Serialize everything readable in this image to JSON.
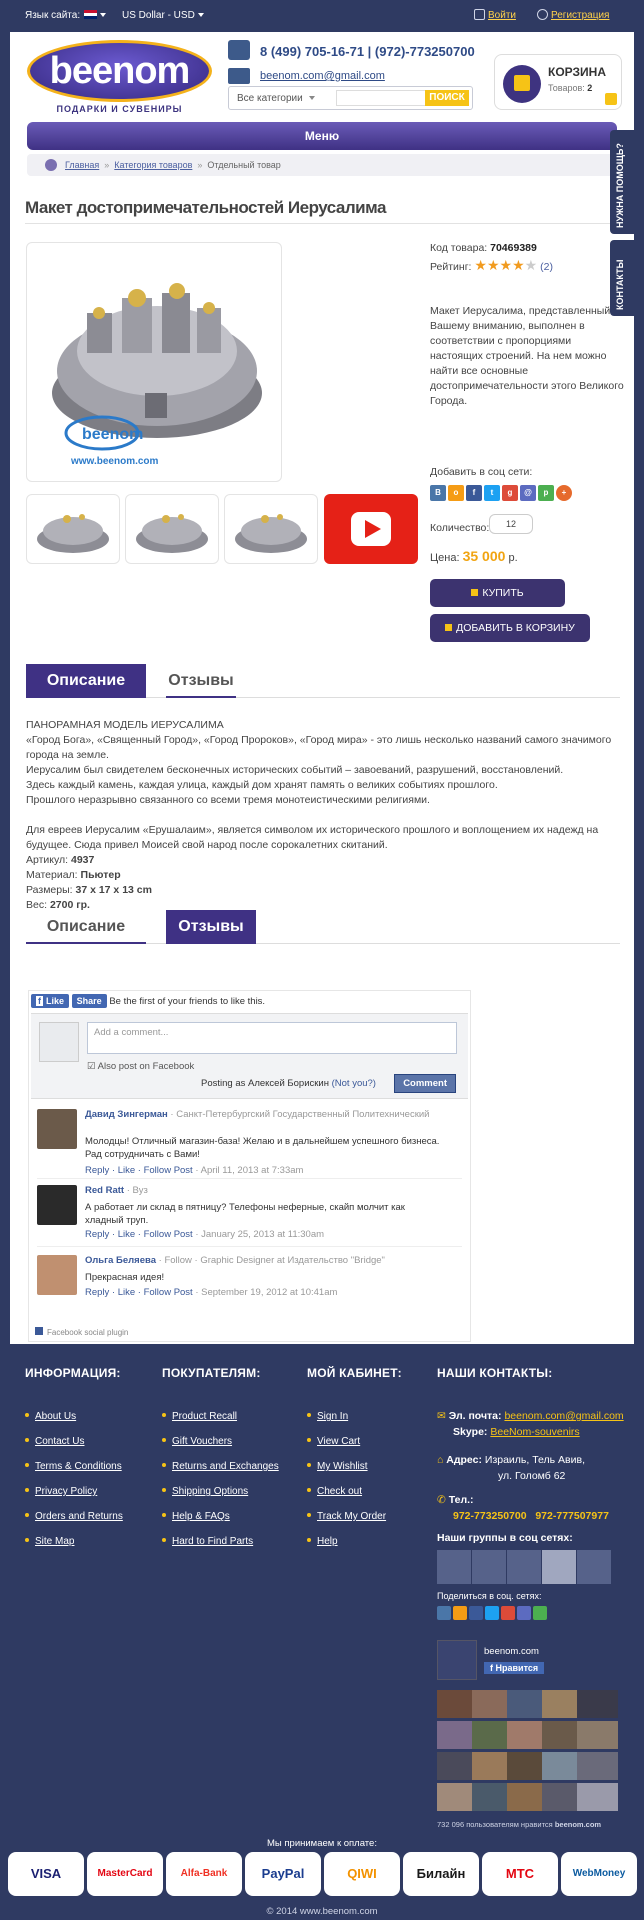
{
  "topbar": {
    "lang_label": "Язык сайта:",
    "currency": "US Dollar - USD",
    "login": "Войти",
    "register": "Регистрация"
  },
  "header": {
    "logo_text": "beenom",
    "logo_sub": "ПОДАРКИ И СУВЕНИРЫ",
    "phone": "8 (499) 705-16-71  |  (972)-773250700",
    "email": "beenom.com@gmail.com",
    "search_category": "Все категории",
    "search_button": "ПОИСК",
    "cart_title": "КОРЗИНА",
    "cart_items_label": "Товаров:",
    "cart_items_count": "2"
  },
  "menu": {
    "label": "Меню"
  },
  "breadcrumb": {
    "home": "Главная",
    "category": "Категория товаров",
    "current": "Отдельный товар"
  },
  "side_tabs": {
    "help": "НУЖНА ПОМОЩЬ?",
    "contacts": "КОНТАКТЫ"
  },
  "product": {
    "title": "Макет достопримечательностей Иерусалима",
    "code_label": "Код товара:",
    "code": "70469389",
    "rating_label": "Рейтинг:",
    "rating": 4,
    "rating_max": 5,
    "reviews": "(2)",
    "description": "Макет Иерусалима, представленный Вашему вниманию, выполнен в соответствии с пропорциями настоящих строений. На нем можно найти все основные достопримечательности этого Великого Города.",
    "share_label": "Добавить в соц сети:",
    "qty_label": "Количество:",
    "qty": "12",
    "price_label": "Цена:",
    "price": "35 000",
    "currency": "р.",
    "buy": "КУПИТЬ",
    "add_to_cart": "ДОБАВИТЬ В КОРЗИНУ",
    "watermark": "www.beenom.com"
  },
  "tabs": {
    "description": "Описание",
    "reviews": "Отзывы"
  },
  "details": {
    "heading": "ПАНОРАМНАЯ МОДЕЛЬ ИЕРУСАЛИМА",
    "p1": "«Город Бога», «Священный Город», «Город Пророков», «Город мира» - это лишь несколько названий самого значимого города на земле.",
    "p2": "Иерусалим был свидетелем бесконечных исторических событий – завоеваний, разрушений, восстановлений.",
    "p3": "Здесь каждый камень, каждая улица, каждый дом хранят память о великих событиях прошлого.",
    "p4": "Прошлого неразрывно связанного со всеми тремя монотеистическими религиями.",
    "p5": "Для евреев Иерусалим «Ерушалаим», является символом их исторического прошлого и воплощением их надежд на будущее. Сюда привел Моисей свой народ после сорокалетних скитаний.",
    "sku_label": "Артикул:",
    "sku": "4937",
    "material_label": "Материал:",
    "material": "Пьютер",
    "size_label": "Размеры:",
    "size": "37 x 17 x 13 cm",
    "weight_label": "Вес:",
    "weight": "2700 гр."
  },
  "facebook": {
    "like": "Like",
    "share": "Share",
    "first": "Be the first of your friends to like this.",
    "placeholder": "Add a comment...",
    "also_post": "Also post on Facebook",
    "posting_as": "Posting as Алексей Борискин",
    "not_you": "(Not you?)",
    "comment_btn": "Comment",
    "plugin": "Facebook social plugin",
    "comments": [
      {
        "name": "Давид Зингерман",
        "meta": " · Санкт-Петербургский Государственный Политехнический",
        "text": "Молодцы! Отличный магазин-база! Желаю и в дальнейшем успешного бизнеса. Рад сотрудничать с Вами!",
        "actions": "Reply · Like · Follow Post",
        "date": " · April 11, 2013 at 7:33am"
      },
      {
        "name": "Red Ratt",
        "meta": " · Вуз",
        "text": "А работает ли склад в пятницу? Телефоны неферные, скайп молчит как хладный труп.",
        "actions": "Reply · Like · Follow Post",
        "date": " · January 25, 2013 at 11:30am"
      },
      {
        "name": "Ольга Беляева",
        "meta": " · Follow · Graphic Designer at Издательство \"Bridge\"",
        "text": "Прекрасная идея!",
        "actions": "Reply · Like · Follow Post",
        "date": " · September 19, 2012 at 10:41am"
      }
    ]
  },
  "footer": {
    "info_title": "ИНФОРМАЦИЯ:",
    "info_links": [
      "About Us",
      "Contact Us",
      "Terms & Conditions",
      "Privacy Policy",
      "Orders and Returns",
      "Site Map"
    ],
    "buyers_title": "ПОКУПАТЕЛЯМ:",
    "buyers_links": [
      "Product Recall",
      "Gift Vouchers",
      "Returns and Exchanges",
      "Shipping Options",
      "Help & FAQs",
      "Hard to Find Parts"
    ],
    "cabinet_title": "МОЙ КАБИНЕТ:",
    "cabinet_links": [
      "Sign In",
      "View Cart",
      "My Wishlist",
      "Check out",
      "Track My Order",
      "Help"
    ],
    "contacts_title": "НАШИ КОНТАКТЫ:",
    "email_label": "Эл. почта:",
    "email": "beenom.com@gmail.com",
    "skype_label": "Skype:",
    "skype": "BeeNom-souvenirs",
    "address_label": "Адрес:",
    "address1": "Израиль, Тель Авив,",
    "address2": "ул. Голомб 62",
    "tel_label": "Тел.:",
    "tel1": "972-773250700",
    "tel2": "972-777507977",
    "groups_title": "Наши группы в соц сетях:",
    "share_title": "Поделиться в соц. сетях:",
    "fb_page": "beenom.com",
    "fb_like": "Нравится",
    "fb_count": "732 096 пользователям нравится",
    "fb_count_name": "beenom.com"
  },
  "payments": {
    "label": "Мы принимаем к оплате:",
    "cards": [
      "VISA",
      "MasterCard",
      "Alfa-Bank",
      "PayPal",
      "QIWI",
      "Билайн",
      "МТС",
      "WebMoney"
    ]
  },
  "copyright": "© 2014 www.beenom.com"
}
